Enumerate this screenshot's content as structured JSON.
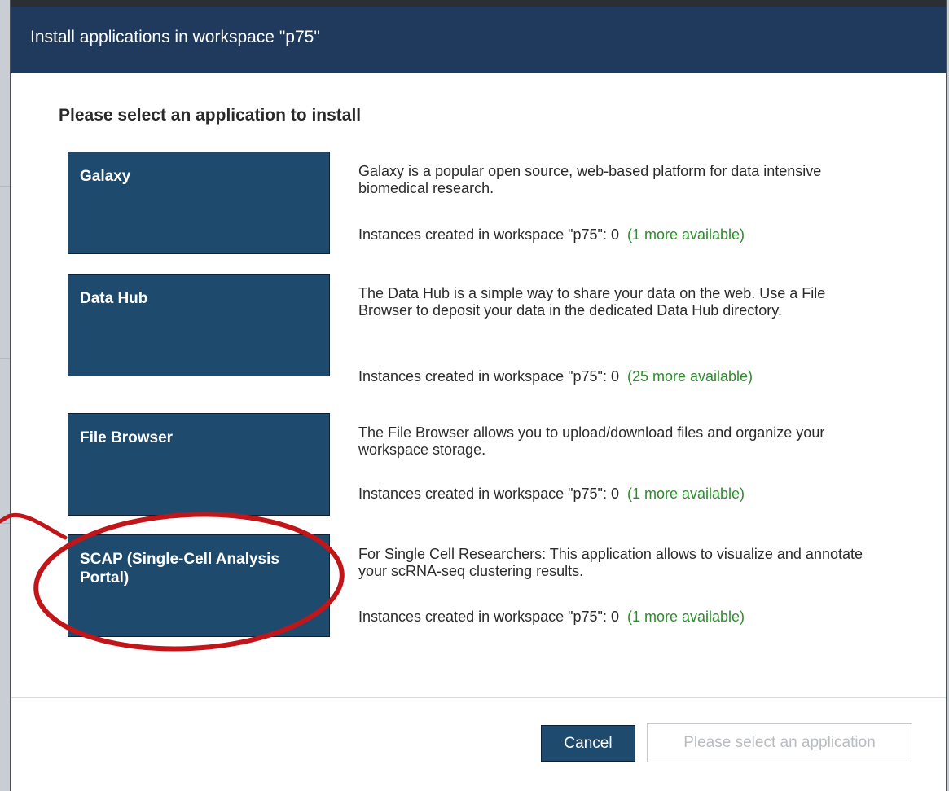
{
  "dialog": {
    "title": "Install applications in workspace \"p75\"",
    "section_title": "Please select an application to install",
    "apps": [
      {
        "name": "Galaxy",
        "description": "Galaxy is a popular open source, web-based platform for data intensive biomedical research.",
        "instances_label": "Instances created in workspace \"p75\": 0",
        "availability": "(1 more available)"
      },
      {
        "name": "Data Hub",
        "description": "The Data Hub is a simple way to share your data on the web. Use a File Browser to deposit your data in the dedicated Data Hub directory.",
        "instances_label": "Instances created in workspace \"p75\": 0",
        "availability": "(25 more available)"
      },
      {
        "name": "File Browser",
        "description": "The File Browser allows you to upload/download files and organize your workspace storage.",
        "instances_label": "Instances created in workspace \"p75\": 0",
        "availability": "(1 more available)"
      },
      {
        "name": "SCAP (Single-Cell Analysis Portal)",
        "description": "For Single Cell Researchers: This application allows to visualize and annotate your scRNA-seq clustering results.",
        "instances_label": "Instances created in workspace \"p75\": 0",
        "availability": "(1 more available)"
      }
    ],
    "footer": {
      "cancel_label": "Cancel",
      "confirm_label": "Please select an application"
    }
  },
  "colors": {
    "header_bg": "#1f3a5c",
    "tile_bg": "#1e4a6e",
    "available_text": "#2e8b2e",
    "annotation_stroke": "#c0161a"
  }
}
